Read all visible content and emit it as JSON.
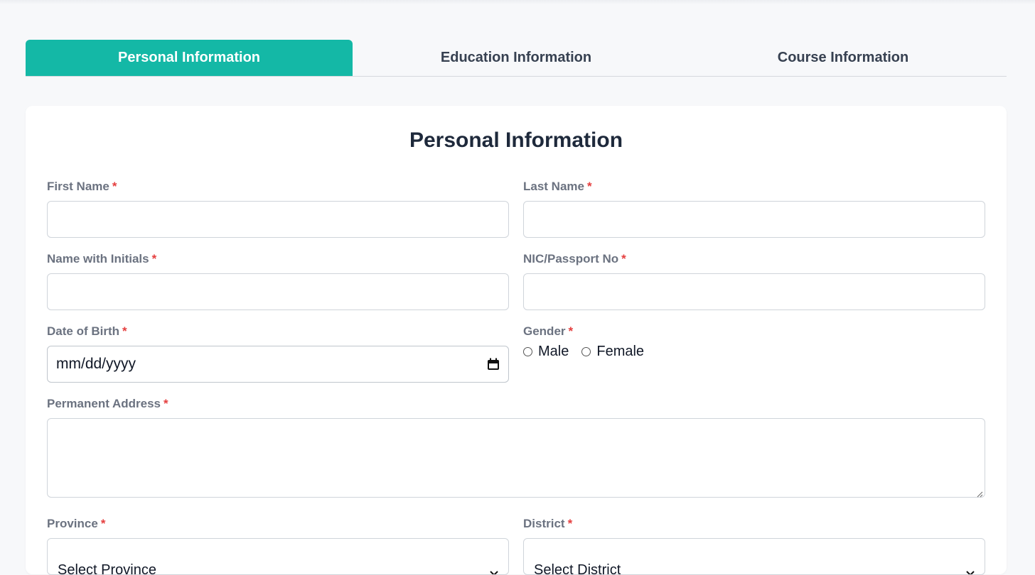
{
  "tabs": [
    {
      "label": "Personal Information",
      "active": true
    },
    {
      "label": "Education Information",
      "active": false
    },
    {
      "label": "Course Information",
      "active": false
    }
  ],
  "colors": {
    "accent": "#14b8a6",
    "required": "#e53e3e",
    "label": "#6b7280"
  },
  "form": {
    "title": "Personal Information",
    "required_mark": "*",
    "first_name": {
      "label": "First Name",
      "value": ""
    },
    "last_name": {
      "label": "Last Name",
      "value": ""
    },
    "name_with_initials": {
      "label": "Name with Initials",
      "value": ""
    },
    "nic_passport": {
      "label": "NIC/Passport No",
      "value": ""
    },
    "date_of_birth": {
      "label": "Date of Birth",
      "placeholder": "mm/dd/yyyy",
      "icon": "calendar-icon"
    },
    "gender": {
      "label": "Gender",
      "options": [
        "Male",
        "Female"
      ]
    },
    "permanent_address": {
      "label": "Permanent Address",
      "value": ""
    },
    "province": {
      "label": "Province",
      "selected": "Select Province"
    },
    "district": {
      "label": "District",
      "selected": "Select District"
    }
  }
}
